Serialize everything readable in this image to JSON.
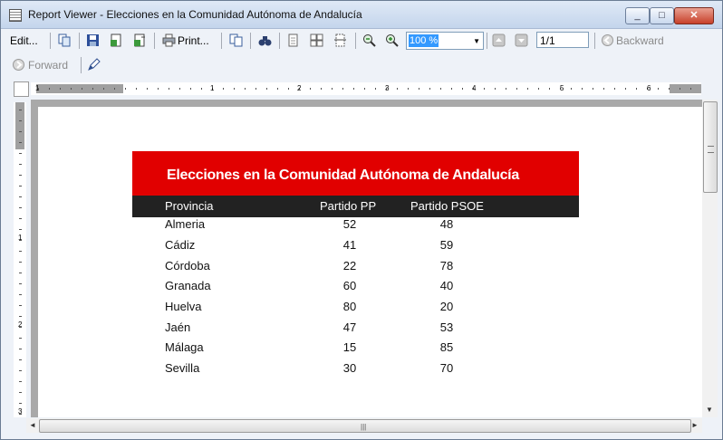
{
  "window": {
    "title": "Report Viewer - Elecciones en la Comunidad Autónoma de Andalucía"
  },
  "toolbar": {
    "edit": "Edit...",
    "print": "Print...",
    "zoom": "100 %",
    "page": "1/1",
    "backward": "Backward",
    "forward": "Forward"
  },
  "ruler": {
    "h_numbers": [
      "1",
      "1",
      "2",
      "3",
      "4",
      "5",
      "6"
    ],
    "v_numbers": [
      "1",
      "2",
      "3"
    ]
  },
  "report": {
    "title": "Elecciones en la Comunidad Autónoma de Andalucía",
    "columns": [
      "Provincia",
      "Partido PP",
      "Partido PSOE"
    ],
    "rows": [
      [
        "Almeria",
        "52",
        "48"
      ],
      [
        "Cádiz",
        "41",
        "59"
      ],
      [
        "Córdoba",
        "22",
        "78"
      ],
      [
        "Granada",
        "60",
        "40"
      ],
      [
        "Huelva",
        "80",
        "20"
      ],
      [
        "Jaén",
        "47",
        "53"
      ],
      [
        "Málaga",
        "15",
        "85"
      ],
      [
        "Sevilla",
        "30",
        "70"
      ]
    ]
  },
  "colors": {
    "header_red": "#e10000",
    "column_bar": "#222222",
    "preview_bg": "#a9a9a9"
  }
}
